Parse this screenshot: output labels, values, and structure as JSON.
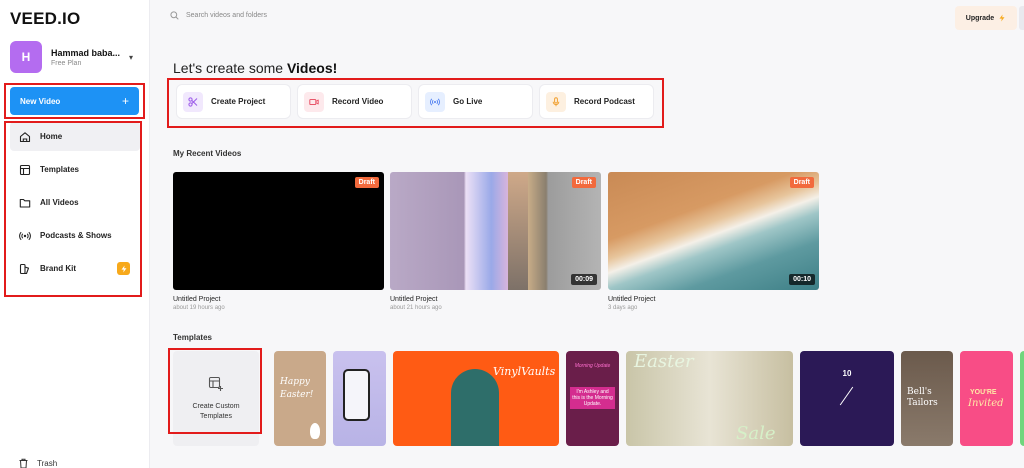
{
  "app": {
    "logo": "VEED.IO"
  },
  "user": {
    "initial": "H",
    "name": "Hammad baba...",
    "plan": "Free Plan"
  },
  "sidebar": {
    "new_video_label": "New Video",
    "items": [
      {
        "label": "Home",
        "icon": "home-icon",
        "active": true
      },
      {
        "label": "Templates",
        "icon": "templates-icon"
      },
      {
        "label": "All Videos",
        "icon": "folder-icon"
      },
      {
        "label": "Podcasts & Shows",
        "icon": "broadcast-icon"
      },
      {
        "label": "Brand Kit",
        "icon": "brand-kit-icon",
        "badge": "bolt-icon"
      }
    ],
    "trash_label": "Trash"
  },
  "header": {
    "search_placeholder": "Search videos and folders",
    "upgrade_label": "Upgrade"
  },
  "main": {
    "heading_prefix": "Let's create some ",
    "heading_bold": "Videos!",
    "actions": [
      {
        "label": "Create Project",
        "icon": "scissors-icon",
        "bg": "#f1e8fd",
        "fg": "#9b59e8"
      },
      {
        "label": "Record Video",
        "icon": "record-video-icon",
        "bg": "#fde9ec",
        "fg": "#e8566a"
      },
      {
        "label": "Go Live",
        "icon": "live-icon",
        "bg": "#e6efff",
        "fg": "#4f7ff0"
      },
      {
        "label": "Record Podcast",
        "icon": "microphone-icon",
        "bg": "#fdf0e0",
        "fg": "#f0a030"
      }
    ],
    "recent_title": "My Recent Videos",
    "videos": [
      {
        "title": "Untitled Project",
        "time": "about 19 hours ago",
        "badge": "Draft",
        "duration": ""
      },
      {
        "title": "Untitled Project",
        "time": "about 21 hours ago",
        "badge": "Draft",
        "duration": "00:09"
      },
      {
        "title": "Untitled Project",
        "time": "3 days ago",
        "badge": "Draft",
        "duration": "00:10"
      }
    ],
    "templates_title": "Templates",
    "custom_template_label_1": "Create Custom",
    "custom_template_label_2": "Templates",
    "template_texts": {
      "easter_1": "Happy",
      "easter_2": "Easter!",
      "vinyl": "VinylVaults",
      "morning_1": "Morning Update",
      "morning_2": "I'm Ashley and this is the Morning Update.",
      "easter_sale_1": "Easter",
      "easter_sale_2": "Sale",
      "clock": "10",
      "tailors_1": "Bell's",
      "tailors_2": "Tailors",
      "invited_1": "YOU'RE",
      "invited_2": "Invited"
    }
  },
  "colors": {
    "accent": "#1d92f5",
    "draft": "#f26a3d",
    "highlight": "#e21b1b"
  }
}
